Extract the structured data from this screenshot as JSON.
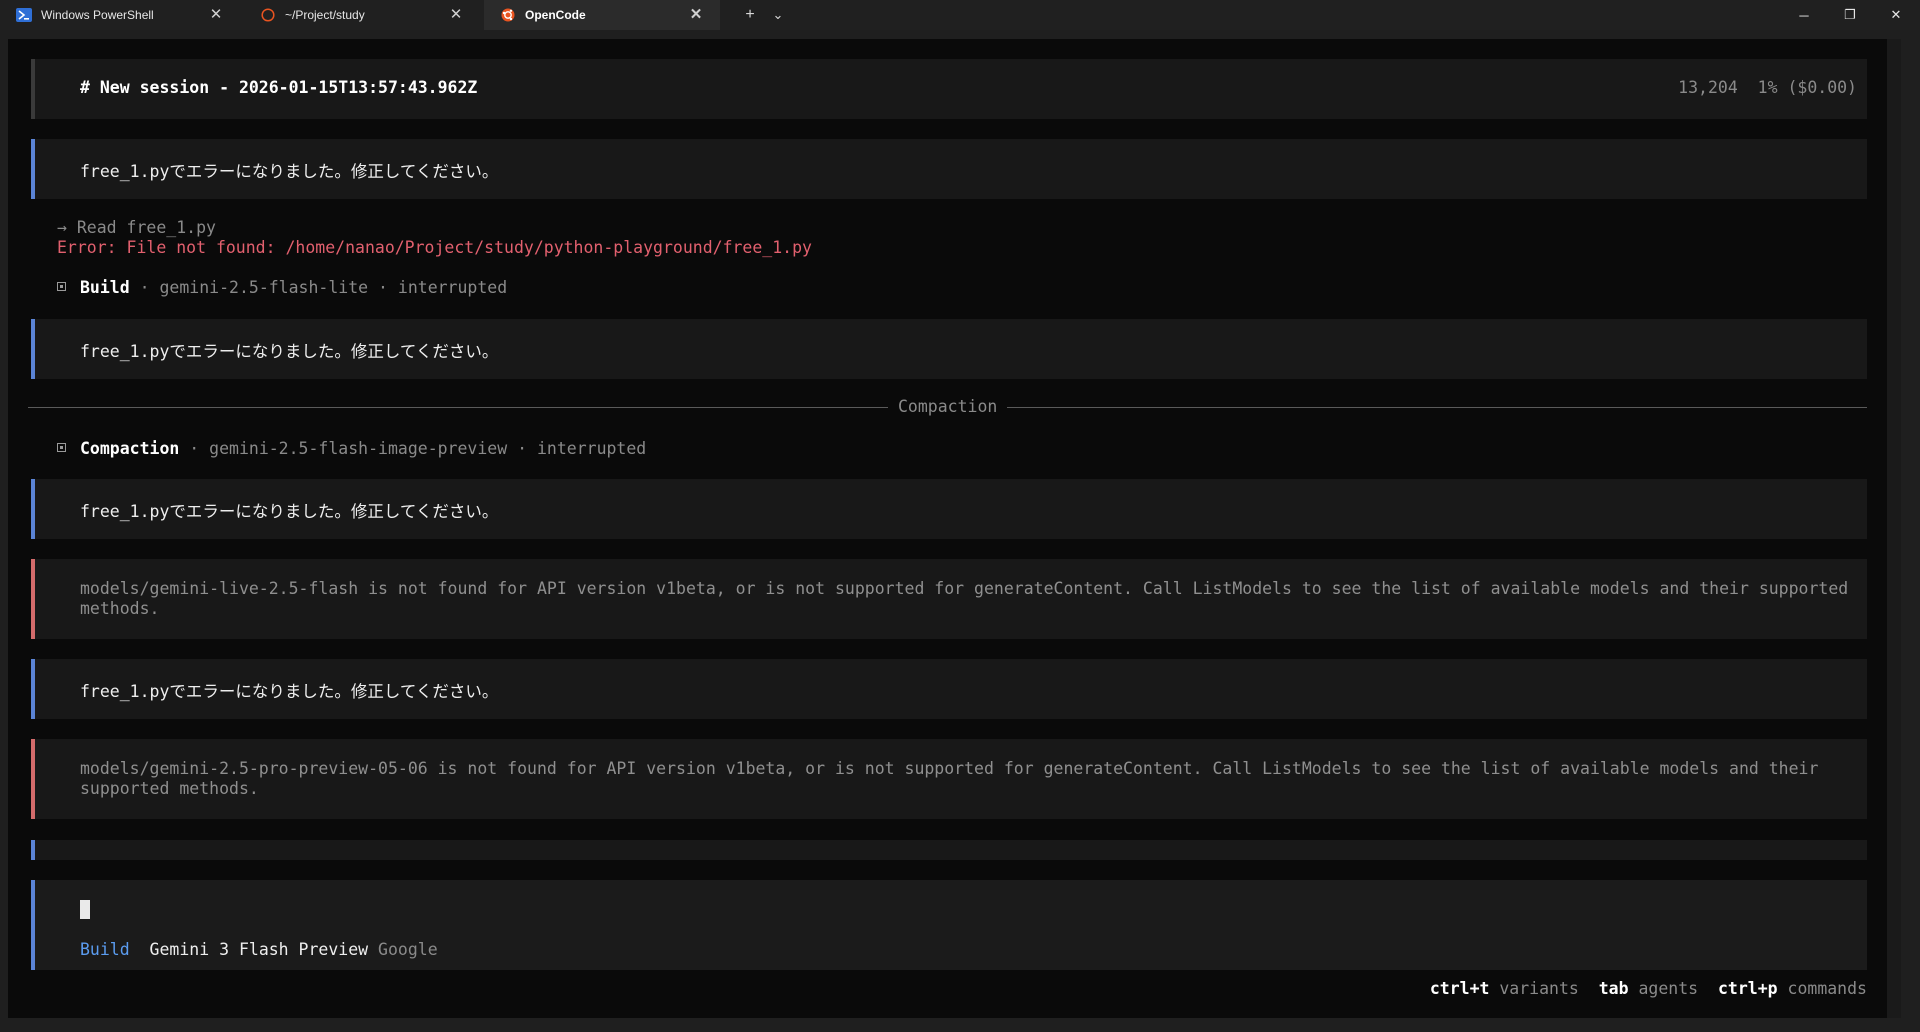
{
  "tabs": [
    {
      "label": "Windows PowerShell",
      "icon": "powershell-icon"
    },
    {
      "label": "~/Project/study",
      "icon": "ubuntu-circle-icon"
    },
    {
      "label": "OpenCode",
      "icon": "opencode-icon",
      "active": true
    }
  ],
  "tabbar": {
    "new_tab": "+",
    "dropdown": "⌄"
  },
  "window": {
    "minimize": "─",
    "maximize": "❐",
    "close": "✕"
  },
  "session": {
    "title": "# New session - 2026-01-15T13:57:43.962Z",
    "tokens": "13,204",
    "usage": "1% ($0.00)"
  },
  "messages": {
    "user_1": "free_1.pyでエラーになりました。修正してください。",
    "tool_read": "→ Read free_1.py",
    "error_line": "Error: File not found: /home/nanao/Project/study/python-playground/free_1.py",
    "build_1": {
      "agent": "Build",
      "meta": "· gemini-2.5-flash-lite · interrupted"
    },
    "user_2": "free_1.pyでエラーになりました。修正してください。",
    "compaction_label": "Compaction",
    "compaction": {
      "agent": "Compaction",
      "meta": "· gemini-2.5-flash-image-preview · interrupted"
    },
    "user_3": "free_1.pyでエラーになりました。修正してください。",
    "error_1": "models/gemini-live-2.5-flash is not found for API version v1beta, or is not supported for generateContent. Call ListModels to see the list of available models and their supported methods.",
    "user_4": "free_1.pyでエラーになりました。修正してください。",
    "error_2": "models/gemini-2.5-pro-preview-05-06 is not found for API version v1beta, or is not supported for generateContent. Call ListModels to see the list of available models and their supported methods."
  },
  "prompt": {
    "agent": "Build",
    "model": "Gemini 3 Flash Preview",
    "provider": "Google"
  },
  "shortcuts": [
    {
      "key": "ctrl+t",
      "label": "variants"
    },
    {
      "key": "tab",
      "label": "agents"
    },
    {
      "key": "ctrl+p",
      "label": "commands"
    }
  ],
  "colors": {
    "accent": "#5b9cf0",
    "error": "#e2606e",
    "user_bar": "#5b84d6",
    "error_bar": "#d36b6b"
  }
}
